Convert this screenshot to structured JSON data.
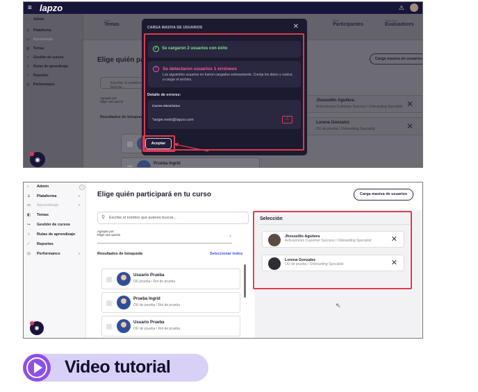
{
  "app": {
    "logo": "lapzo",
    "menu_icon": "hamburger-icon",
    "bell_icon": "bell-icon"
  },
  "colors": {
    "navy": "#17153a",
    "highlight_red": "#e03a4f",
    "success": "#7fe28a",
    "error_pink": "#f45ab0",
    "link_blue": "#3b4fd6",
    "banner_purple": "#8e4fe8",
    "banner_bg": "#d9d0f7"
  },
  "sidebar": {
    "back_label": "Admin",
    "collapse_symbol": "‹",
    "items": [
      {
        "label": "Plataforma",
        "icon": "user-icon",
        "glyph": "♙"
      },
      {
        "label": "Aprendizaje",
        "icon": "book-icon",
        "glyph": "▭"
      },
      {
        "label": "Temas",
        "icon": "tag-icon",
        "glyph": "◧"
      },
      {
        "label": "Gestión de cursos",
        "icon": "share-icon",
        "glyph": "↪"
      },
      {
        "label": "Rutas de aprendizaje",
        "icon": "route-icon",
        "glyph": "♘"
      },
      {
        "label": "Reportes",
        "icon": "chart-icon",
        "glyph": "⟋"
      },
      {
        "label": "Performance",
        "icon": "clock-icon",
        "glyph": "◷"
      }
    ]
  },
  "tabs": [
    {
      "step": "Paso",
      "label": "Temas"
    },
    {
      "step": "Paso",
      "label": "Participantes"
    },
    {
      "step": "Paso final",
      "label": "Evaluadores"
    }
  ],
  "main": {
    "title": "Elige quién participará en tu curso",
    "bulk_button": "Carga masiva de usuarios",
    "search_placeholder": "Escribe el nombre que quieres buscar...",
    "group_by_label": "Agrupar por:",
    "group_by_value": "Elige una opción",
    "results_label": "Resultados de búsqueda",
    "select_all": "Seleccionar todos",
    "results": [
      {
        "name": "Usuario Prueba",
        "sub": "OU prueba / Rol de prueba"
      },
      {
        "name": "Prueba Ingrid",
        "sub": "OU de prueba / Rol de prueba"
      },
      {
        "name": "Usuario Prueba",
        "sub": "OU de prueba / Rol de prueba"
      }
    ]
  },
  "selection": {
    "title": "Selección",
    "items": [
      {
        "name": "Jhossellin Aguilera",
        "sub": "Activaciones Customer Success / Onboarding Specialist"
      },
      {
        "name": "Lorena Gonzalez",
        "sub": "OU de prueba / Onboarding Specialist"
      }
    ]
  },
  "modal": {
    "title": "CARGA MASIVA DE USUARIOS",
    "success": "Se cargaron 2 usuarios con éxito",
    "error_title": "Se detectaron usuarios 1 erróneos",
    "error_desc": "Los siguientes usuarios no fueron cargados exitosamente. Corrija los datos y vuelva a cargar el archivo.",
    "details_label": "Detalle de errores:",
    "column_header": "Correo electrónico",
    "error_email": "*angie.melo@lapzo.com",
    "accept_button": "Aceptar"
  },
  "banner": {
    "label": "Video tutorial"
  }
}
